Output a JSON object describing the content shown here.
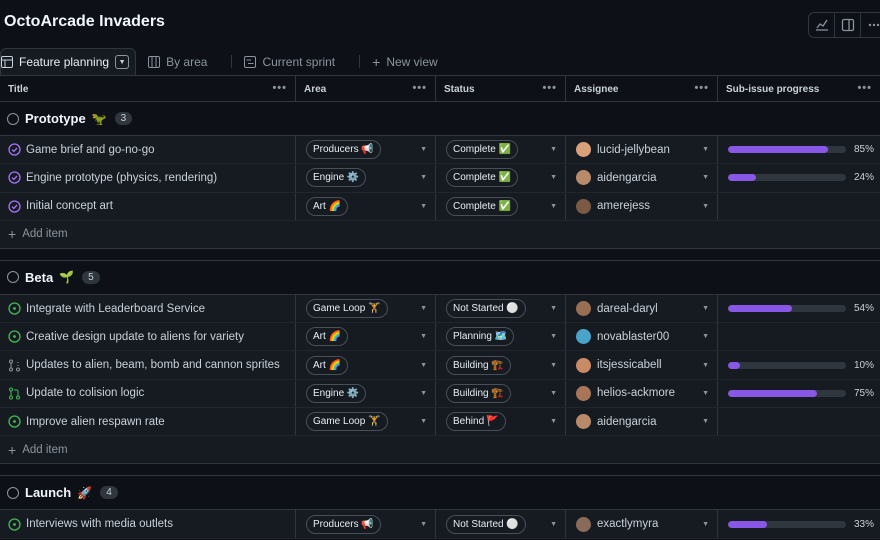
{
  "app": {
    "title": "OctoArcade Invaders"
  },
  "top_actions": [
    {
      "icon": "chart-icon"
    },
    {
      "icon": "sidebar-panel-icon"
    },
    {
      "icon": "more-icon"
    }
  ],
  "tabs": [
    {
      "label": "Feature planning",
      "icon": "table-icon",
      "active": true
    },
    {
      "label": "By area",
      "icon": "board-icon",
      "active": false
    },
    {
      "label": "Current sprint",
      "icon": "roadmap-icon",
      "active": false
    },
    {
      "label": "New view",
      "icon": "plus-icon",
      "active": false
    }
  ],
  "columns": {
    "title": "Title",
    "area": "Area",
    "status": "Status",
    "assignee": "Assignee",
    "progress": "Sub-issue progress",
    "menu": "•••"
  },
  "add_item_label": "Add item",
  "colors": {
    "accent_purple": "#8957e5",
    "open_green": "#3fb950",
    "closed_purple": "#a371f7",
    "background": "#0d1117",
    "row_bg": "#161b22",
    "border": "#30363d"
  },
  "groups": [
    {
      "name": "Prototype",
      "emoji": "🦖",
      "count": "3",
      "rows": [
        {
          "title": "Game brief and go-no-go",
          "state": "closed",
          "area": "Producers 📢",
          "status": "Complete ✅",
          "assignee": "lucid-jellybean",
          "avatar_color": "#d9a07a",
          "progress": 0.85,
          "progress_label": "85%"
        },
        {
          "title": "Engine prototype (physics, rendering)",
          "state": "closed",
          "area": "Engine ⚙️",
          "status": "Complete ✅",
          "assignee": "aidengarcia",
          "avatar_color": "#b88a6a",
          "progress": 0.24,
          "progress_label": "24%"
        },
        {
          "title": "Initial concept art",
          "state": "closed",
          "area": "Art 🌈",
          "status": "Complete ✅",
          "assignee": "amerejess",
          "avatar_color": "#7a5a44",
          "progress": null,
          "progress_label": ""
        }
      ]
    },
    {
      "name": "Beta",
      "emoji": "🌱",
      "count": "5",
      "rows": [
        {
          "title": "Integrate with Leaderboard Service",
          "state": "open",
          "area": "Game Loop 🏋️",
          "status": "Not Started ⚪",
          "assignee": "dareal-daryl",
          "avatar_color": "#9a6e52",
          "progress": 0.54,
          "progress_label": "54%"
        },
        {
          "title": "Creative design update to aliens for variety",
          "state": "open",
          "area": "Art 🌈",
          "status": "Planning 🗺️",
          "assignee": "novablaster00",
          "avatar_color": "#4aa3c9",
          "progress": null,
          "progress_label": ""
        },
        {
          "title": "Updates to alien, beam, bomb and cannon sprites",
          "state": "pr-draft",
          "area": "Art 🌈",
          "status": "Building 🏗️",
          "assignee": "itsjessicabell",
          "avatar_color": "#c98a66",
          "progress": 0.1,
          "progress_label": "10%"
        },
        {
          "title": "Update to colision logic",
          "state": "pr-open",
          "area": "Engine ⚙️",
          "status": "Building 🏗️",
          "assignee": "helios-ackmore",
          "avatar_color": "#a87558",
          "progress": 0.75,
          "progress_label": "75%"
        },
        {
          "title": "Improve alien respawn rate",
          "state": "open",
          "area": "Game Loop 🏋️",
          "status": "Behind 🚩",
          "assignee": "aidengarcia",
          "avatar_color": "#b88a6a",
          "progress": null,
          "progress_label": ""
        }
      ]
    },
    {
      "name": "Launch",
      "emoji": "🚀",
      "count": "4",
      "rows": [
        {
          "title": "Interviews with media outlets",
          "state": "open",
          "area": "Producers 📢",
          "status": "Not Started ⚪",
          "assignee": "exactlymyra",
          "avatar_color": "#8a6a58",
          "progress": 0.33,
          "progress_label": "33%"
        }
      ]
    }
  ]
}
